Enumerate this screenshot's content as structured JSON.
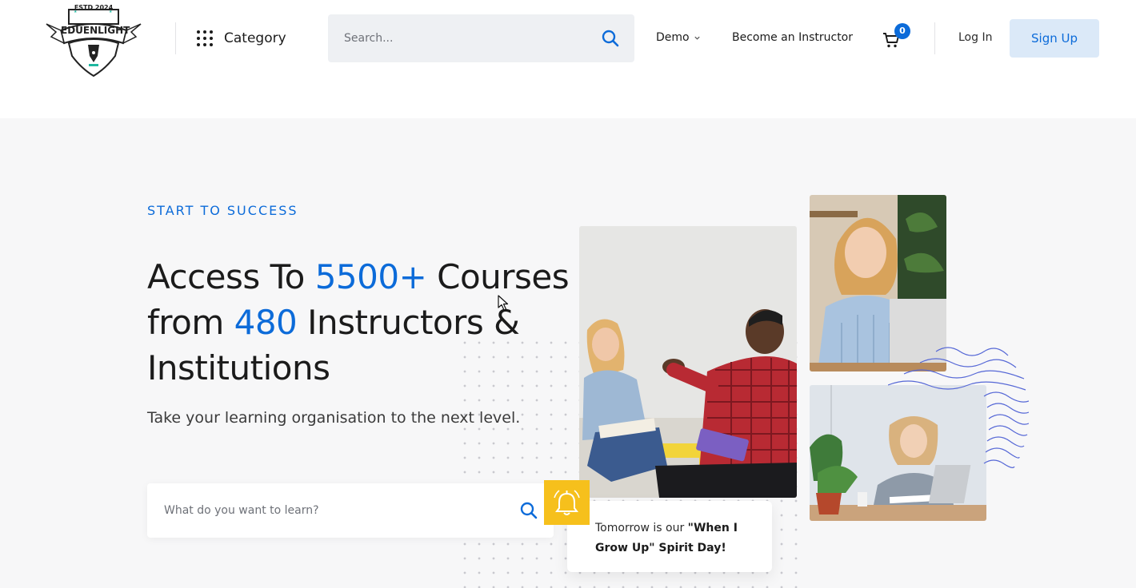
{
  "brand": {
    "logo_top": "ESTD 2024",
    "logo_name": "EDUENLIGHT"
  },
  "header": {
    "category_label": "Category",
    "search_placeholder": "Search...",
    "demo_label": "Demo",
    "instructor_label": "Become an Instructor",
    "cart_count": "0",
    "login_label": "Log In",
    "signup_label": "Sign Up"
  },
  "hero": {
    "eyebrow": "START TO SUCCESS",
    "headline_part1": "Access To ",
    "headline_courses": "5500+",
    "headline_part2": " Courses from ",
    "headline_instructors": "480",
    "headline_part3": " Instructors & Institutions",
    "subtext": "Take your learning organisation to the next level.",
    "search_placeholder": "What do you want to learn?"
  },
  "notice": {
    "text_prefix": "Tomorrow is our ",
    "text_bold": "\"When I Grow Up\" Spirit Day!"
  },
  "colors": {
    "accent": "#0c6bd9",
    "bell": "#f6c01c",
    "signup_bg": "#dbe9f8"
  },
  "icons": {
    "category": "grid-dots-icon",
    "search": "search-icon",
    "demo": "chevron-down-icon",
    "cart": "cart-icon",
    "bell": "bell-icon"
  }
}
